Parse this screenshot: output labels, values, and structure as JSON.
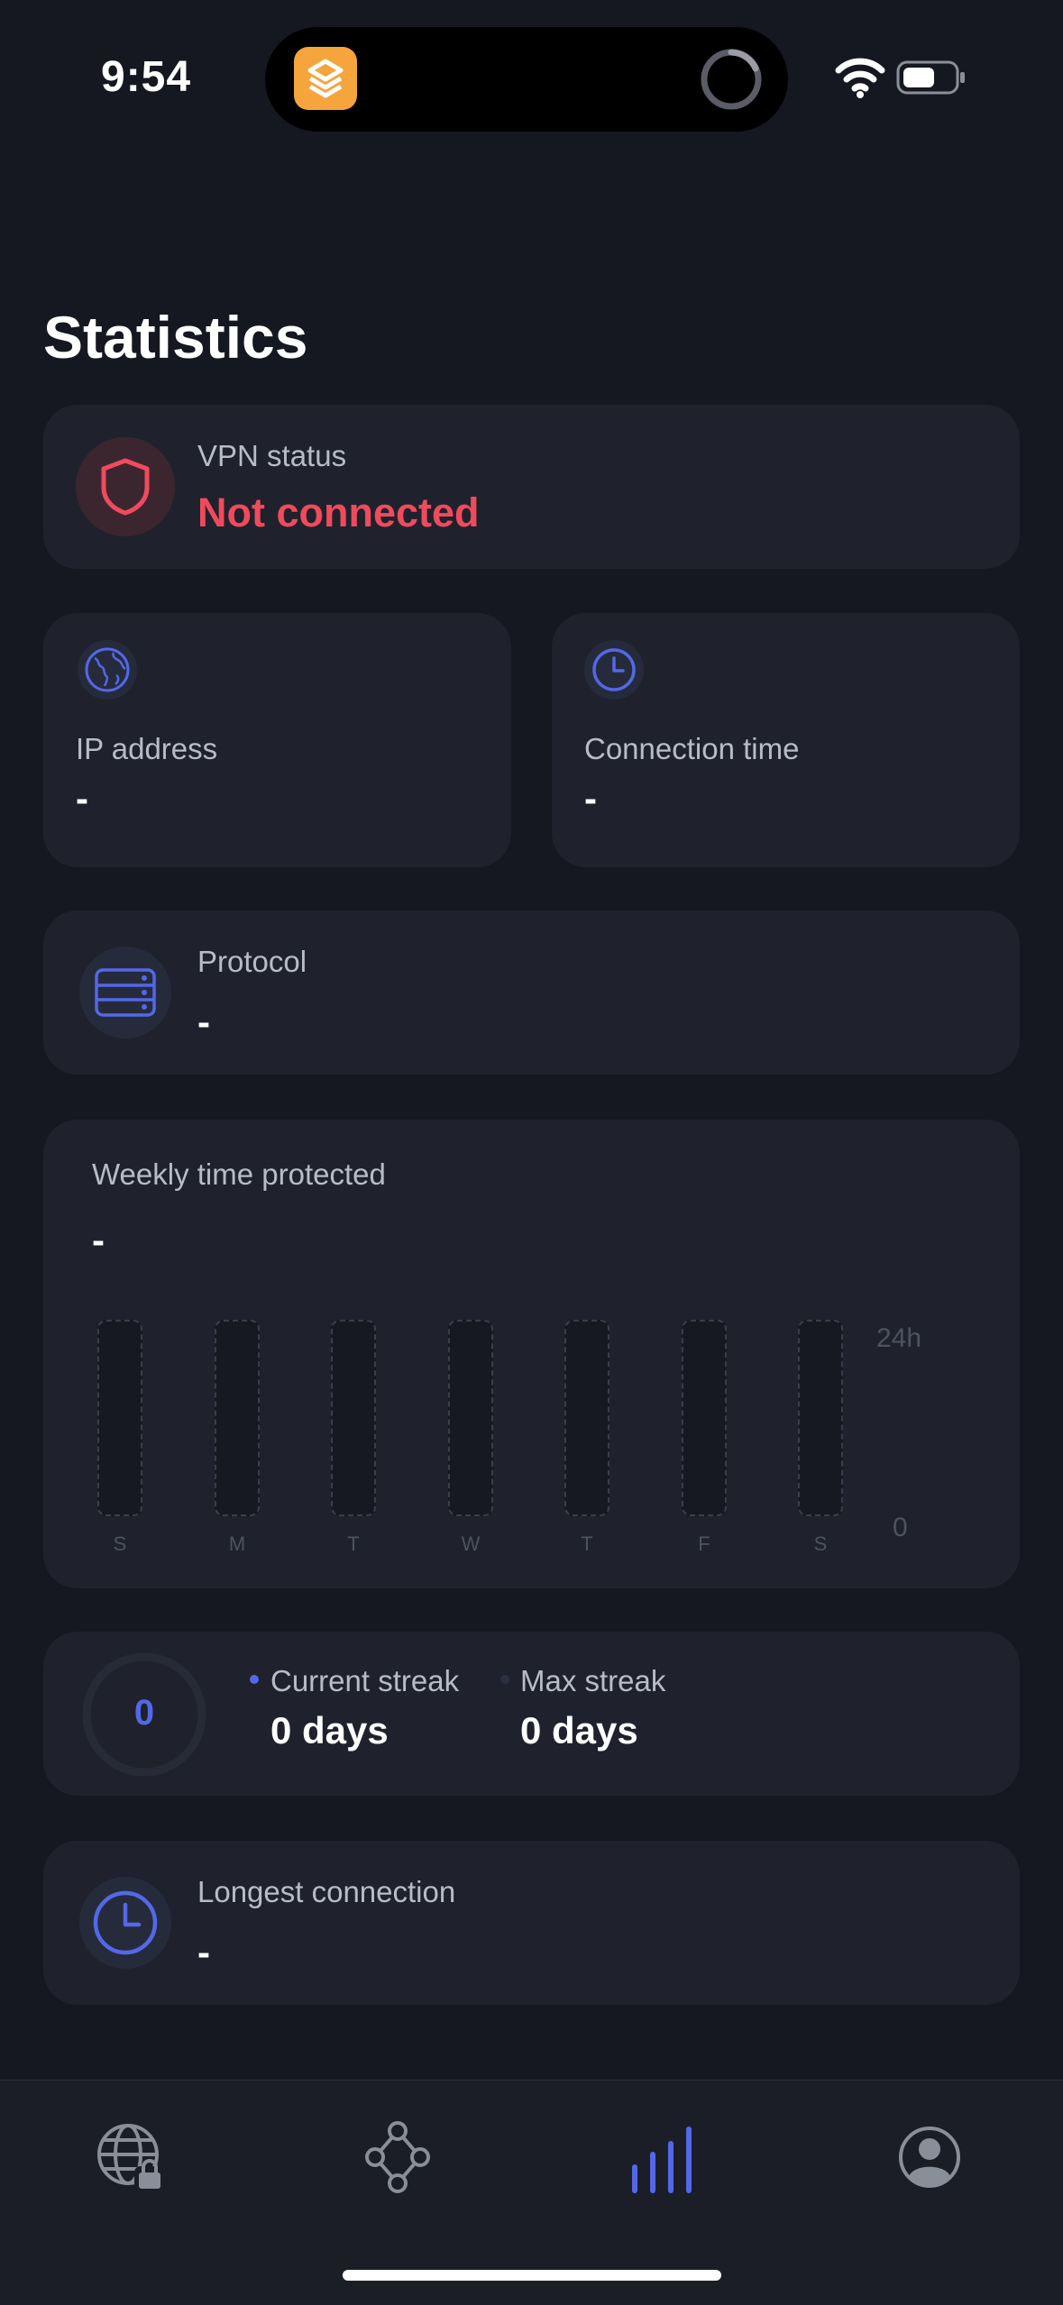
{
  "status_bar": {
    "time": "9:54"
  },
  "page": {
    "title": "Statistics"
  },
  "vpn_status": {
    "label": "VPN status",
    "value": "Not connected",
    "icon": "shield-icon"
  },
  "ip_address": {
    "label": "IP address",
    "value": "-",
    "icon": "globe-icon"
  },
  "connection_time": {
    "label": "Connection time",
    "value": "-",
    "icon": "clock-icon"
  },
  "protocol": {
    "label": "Protocol",
    "value": "-",
    "icon": "server-icon"
  },
  "weekly": {
    "label": "Weekly time protected",
    "value": "-",
    "y_max_label": "24h",
    "y_min_label": "0",
    "days": [
      "S",
      "M",
      "T",
      "W",
      "T",
      "F",
      "S"
    ]
  },
  "chart_data": {
    "type": "bar",
    "categories": [
      "S",
      "M",
      "T",
      "W",
      "T",
      "F",
      "S"
    ],
    "values": [
      0,
      0,
      0,
      0,
      0,
      0,
      0
    ],
    "title": "Weekly time protected",
    "ylim": [
      0,
      24
    ],
    "ytick_labels": [
      "0",
      "24h"
    ]
  },
  "streak": {
    "ring_value": "0",
    "current_label": "Current streak",
    "current_value": "0 days",
    "max_label": "Max streak",
    "max_value": "0 days"
  },
  "longest_connection": {
    "label": "Longest connection",
    "value": "-",
    "icon": "clock-icon"
  },
  "tab_bar": {
    "items": [
      {
        "icon": "globe-lock-icon",
        "active": false
      },
      {
        "icon": "nodes-icon",
        "active": false
      },
      {
        "icon": "statistics-bars-icon",
        "active": true
      },
      {
        "icon": "profile-icon",
        "active": false
      }
    ]
  },
  "colors": {
    "background": "#151821",
    "card": "#1f222c",
    "accent": "#5368e8",
    "danger": "#f04a5d"
  }
}
